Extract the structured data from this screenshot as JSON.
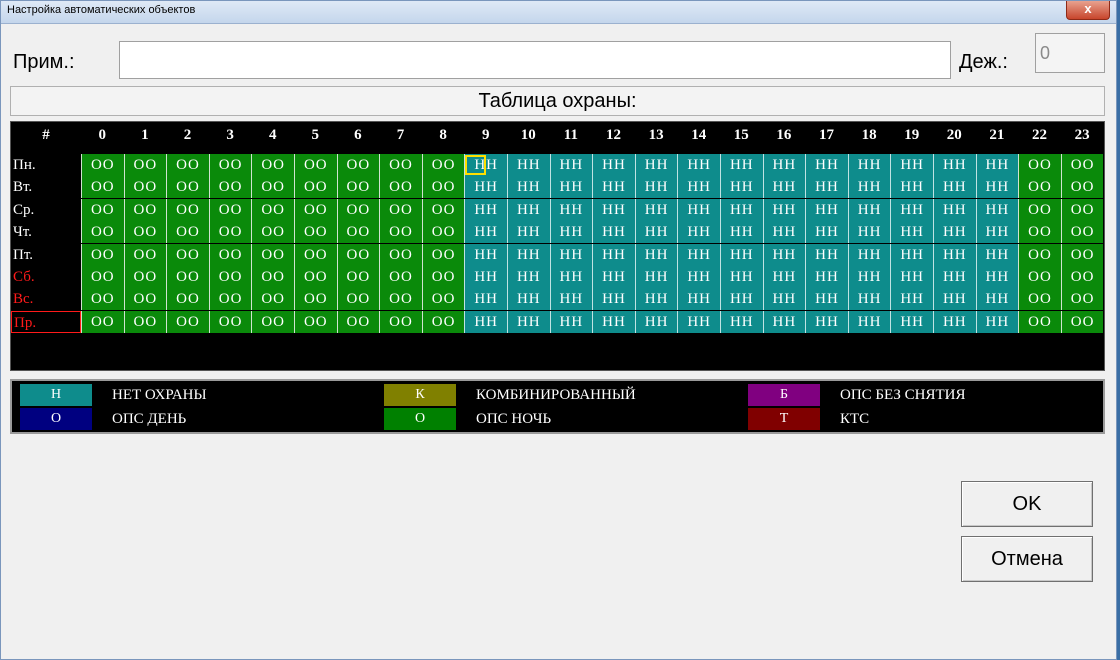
{
  "window": {
    "title": "Настройка автоматических объектов",
    "close_label": "x"
  },
  "form": {
    "prim_label": "Прим.:",
    "prim_value": "",
    "dezh_label": "Деж.:",
    "dezh_value": "0"
  },
  "table": {
    "title": "Таблица охраны:",
    "corner": "#",
    "hours": [
      "0",
      "1",
      "2",
      "3",
      "4",
      "5",
      "6",
      "7",
      "8",
      "9",
      "10",
      "11",
      "12",
      "13",
      "14",
      "15",
      "16",
      "17",
      "18",
      "19",
      "20",
      "21",
      "22",
      "23"
    ],
    "rows": [
      {
        "day": "Пн.",
        "red": false,
        "boxed": false,
        "cells": [
          "OO",
          "OO",
          "OO",
          "OO",
          "OO",
          "OO",
          "OO",
          "OO",
          "OO",
          "HH",
          "HH",
          "HH",
          "HH",
          "HH",
          "HH",
          "HH",
          "HH",
          "HH",
          "HH",
          "HH",
          "HH",
          "HH",
          "OO",
          "OO"
        ]
      },
      {
        "day": "Вт.",
        "red": false,
        "boxed": false,
        "cells": [
          "OO",
          "OO",
          "OO",
          "OO",
          "OO",
          "OO",
          "OO",
          "OO",
          "OO",
          "HH",
          "HH",
          "HH",
          "HH",
          "HH",
          "HH",
          "HH",
          "HH",
          "HH",
          "HH",
          "HH",
          "HH",
          "HH",
          "OO",
          "OO"
        ]
      },
      {
        "day": "Ср.",
        "red": false,
        "boxed": false,
        "cells": [
          "OO",
          "OO",
          "OO",
          "OO",
          "OO",
          "OO",
          "OO",
          "OO",
          "OO",
          "HH",
          "HH",
          "HH",
          "HH",
          "HH",
          "HH",
          "HH",
          "HH",
          "HH",
          "HH",
          "HH",
          "HH",
          "HH",
          "OO",
          "OO"
        ]
      },
      {
        "day": "Чт.",
        "red": false,
        "boxed": false,
        "cells": [
          "OO",
          "OO",
          "OO",
          "OO",
          "OO",
          "OO",
          "OO",
          "OO",
          "OO",
          "HH",
          "HH",
          "HH",
          "HH",
          "HH",
          "HH",
          "HH",
          "HH",
          "HH",
          "HH",
          "HH",
          "HH",
          "HH",
          "OO",
          "OO"
        ]
      },
      {
        "day": "Пт.",
        "red": false,
        "boxed": false,
        "cells": [
          "OO",
          "OO",
          "OO",
          "OO",
          "OO",
          "OO",
          "OO",
          "OO",
          "OO",
          "HH",
          "HH",
          "HH",
          "HH",
          "HH",
          "HH",
          "HH",
          "HH",
          "HH",
          "HH",
          "HH",
          "HH",
          "HH",
          "OO",
          "OO"
        ]
      },
      {
        "day": "Сб.",
        "red": true,
        "boxed": false,
        "cells": [
          "OO",
          "OO",
          "OO",
          "OO",
          "OO",
          "OO",
          "OO",
          "OO",
          "OO",
          "HH",
          "HH",
          "HH",
          "HH",
          "HH",
          "HH",
          "HH",
          "HH",
          "HH",
          "HH",
          "HH",
          "HH",
          "HH",
          "OO",
          "OO"
        ]
      },
      {
        "day": "Вс.",
        "red": true,
        "boxed": false,
        "cells": [
          "OO",
          "OO",
          "OO",
          "OO",
          "OO",
          "OO",
          "OO",
          "OO",
          "OO",
          "HH",
          "HH",
          "HH",
          "HH",
          "HH",
          "HH",
          "HH",
          "HH",
          "HH",
          "HH",
          "HH",
          "HH",
          "HH",
          "OO",
          "OO"
        ]
      },
      {
        "day": "Пр.",
        "red": true,
        "boxed": true,
        "cells": [
          "OO",
          "OO",
          "OO",
          "OO",
          "OO",
          "OO",
          "OO",
          "OO",
          "OO",
          "HH",
          "HH",
          "HH",
          "HH",
          "HH",
          "HH",
          "HH",
          "HH",
          "HH",
          "HH",
          "HH",
          "HH",
          "HH",
          "OO",
          "OO"
        ]
      }
    ],
    "selected": {
      "row": 0,
      "hour": 9,
      "half": 0
    },
    "colors": {
      "O": "#0a8a0a",
      "H": "#0e8c8c"
    }
  },
  "legend": [
    {
      "code": "Н",
      "label": "НЕТ ОХРАНЫ",
      "color": "#0e8c8c"
    },
    {
      "code": "К",
      "label": "КОМБИНИРОВАННЫЙ",
      "color": "#808000"
    },
    {
      "code": "Б",
      "label": "ОПС БЕЗ СНЯТИЯ",
      "color": "#800080"
    },
    {
      "code": "О",
      "label": "ОПС ДЕНЬ",
      "color": "#000080"
    },
    {
      "code": "О",
      "label": "ОПС НОЧЬ",
      "color": "#008000"
    },
    {
      "code": "Т",
      "label": "КТС",
      "color": "#800000"
    }
  ],
  "buttons": {
    "ok": "OK",
    "cancel": "Отмена"
  }
}
